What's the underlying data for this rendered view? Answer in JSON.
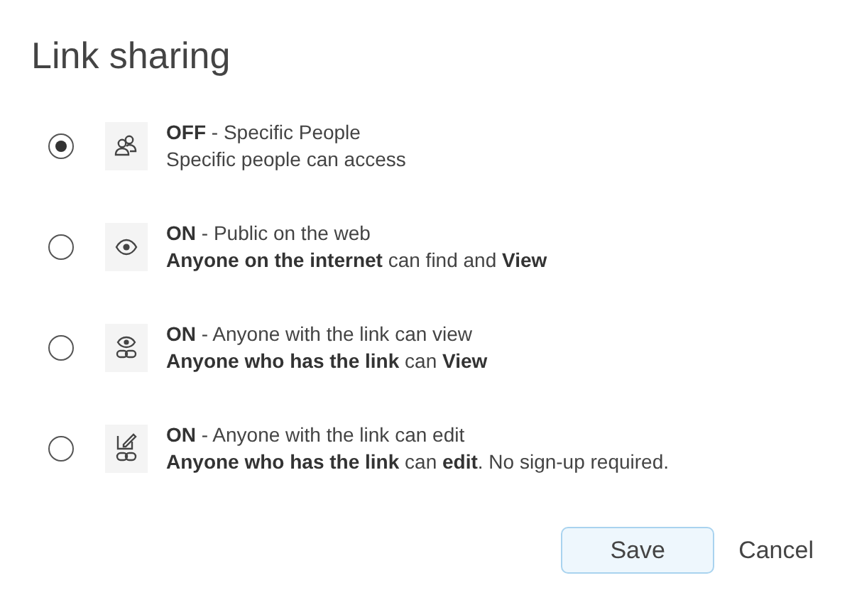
{
  "title": "Link sharing",
  "options": [
    {
      "kind": "people",
      "selected": true,
      "heading": "**OFF** - Specific People",
      "description": "Specific people can access"
    },
    {
      "kind": "eye",
      "selected": false,
      "heading": "**ON** - Public on the web",
      "description": "**Anyone on the internet** can find and **View**"
    },
    {
      "kind": "eye-link",
      "selected": false,
      "heading": "**ON** - Anyone with the link can view",
      "description": "**Anyone who has the link** can **View**"
    },
    {
      "kind": "edit-link",
      "selected": false,
      "heading": "**ON** - Anyone with the link can edit",
      "description": "**Anyone who has the link** can **edit**. No sign-up required."
    }
  ],
  "buttons": [
    {
      "kind": "primary",
      "label": "Save"
    },
    {
      "kind": "plain",
      "label": "Cancel"
    }
  ]
}
